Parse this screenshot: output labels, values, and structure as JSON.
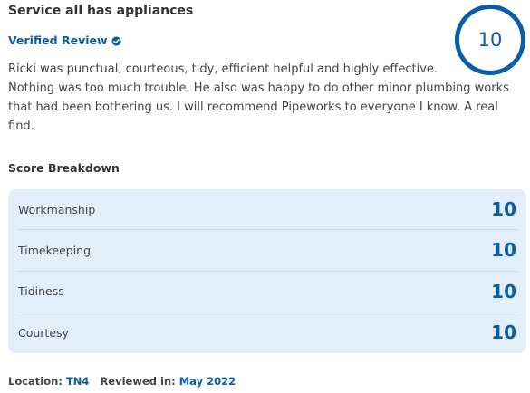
{
  "review": {
    "title": "Service all has appliances",
    "verified_label": "Verified Review",
    "overall_score": "10",
    "text": [
      "Ricki was punctual, courteous, tidy, efficient helpful and highly effective.",
      "Nothing was too much trouble. He also was happy to do other minor plumbing works that had been bothering us. I will recommend Pipeworks to everyone I know. A real find."
    ]
  },
  "breakdown": {
    "title": "Score Breakdown",
    "rows": [
      {
        "label": "Workmanship",
        "value": "10"
      },
      {
        "label": "Timekeeping",
        "value": "10"
      },
      {
        "label": "Tidiness",
        "value": "10"
      },
      {
        "label": "Courtesy",
        "value": "10"
      }
    ]
  },
  "footer": {
    "location_label": "Location:",
    "location_value": "TN4",
    "reviewed_label": "Reviewed in:",
    "reviewed_value": "May 2022"
  },
  "colors": {
    "accent": "#0a5da8",
    "panel_bg": "#e2eefa"
  },
  "icons": {
    "verified": "verified-check-icon"
  }
}
